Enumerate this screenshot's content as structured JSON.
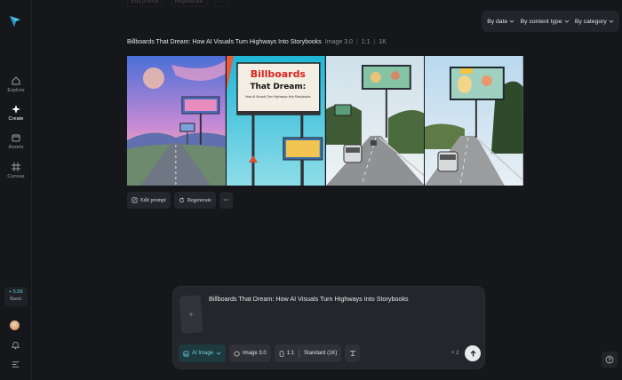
{
  "nav": {
    "items": [
      {
        "label": "Explore",
        "icon": "home-icon"
      },
      {
        "label": "Create",
        "icon": "sparkle-icon"
      },
      {
        "label": "Assets",
        "icon": "folder-icon"
      },
      {
        "label": "Canvas",
        "icon": "canvas-icon"
      }
    ],
    "credits": {
      "amount": "+ 5.5K",
      "plan": "Basic"
    }
  },
  "top": {
    "faded": [
      "Edit prompt",
      "Regenerate",
      "···"
    ]
  },
  "filters": [
    {
      "label": "By date"
    },
    {
      "label": "By content type"
    },
    {
      "label": "By category"
    }
  ],
  "gallery": {
    "title": "Billboards That Dream: How AI Visuals Turn Highways Into Storybooks",
    "model": "Image 3.0",
    "ratio": "1:1",
    "resolution": "1K",
    "billboard_text": {
      "headline_red": "Billboards",
      "headline_black": "That Dream:",
      "subline": "How AI Visuals Turn Highways Into Storybooks"
    },
    "actions": {
      "edit": "Edit prompt",
      "regenerate": "Regenerate",
      "more": "···"
    }
  },
  "composer": {
    "prompt": "Billboards That Dream: How AI Visuals Turn Highways Into Storybooks",
    "ref_plus": "+",
    "mode": "AI Image",
    "model": "Image 3.0",
    "ratio": "1:1",
    "quality": "Standard (1K)",
    "count": "+ 2"
  },
  "colors": {
    "accent": "#5ad1e6",
    "background": "#16171b",
    "panel": "#25262b"
  }
}
